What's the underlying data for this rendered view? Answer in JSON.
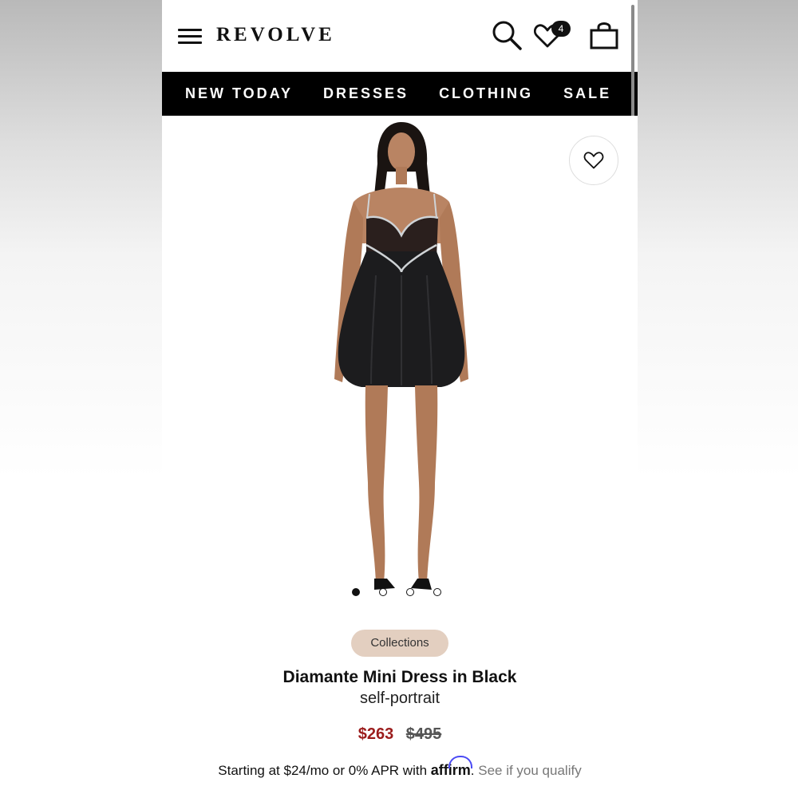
{
  "header": {
    "logo": "REVOLVE",
    "wishlist_count": "4"
  },
  "nav": {
    "items": [
      "NEW TODAY",
      "DRESSES",
      "CLOTHING",
      "SALE"
    ]
  },
  "gallery": {
    "slide_count": 4,
    "active_slide": 1
  },
  "product": {
    "tag": "Collections",
    "title": "Diamante Mini Dress in Black",
    "brand": "self-portrait",
    "price_sale": "$263",
    "price_original": "$495",
    "financing_prefix": "Starting at $24/mo or 0% APR with",
    "financing_provider": "affirm",
    "financing_link": "See if you qualify"
  },
  "colors": {
    "sale_price": "#9b1c1c",
    "tag_bg": "#e3cfc0",
    "affirm_blue": "#4a4af4"
  }
}
